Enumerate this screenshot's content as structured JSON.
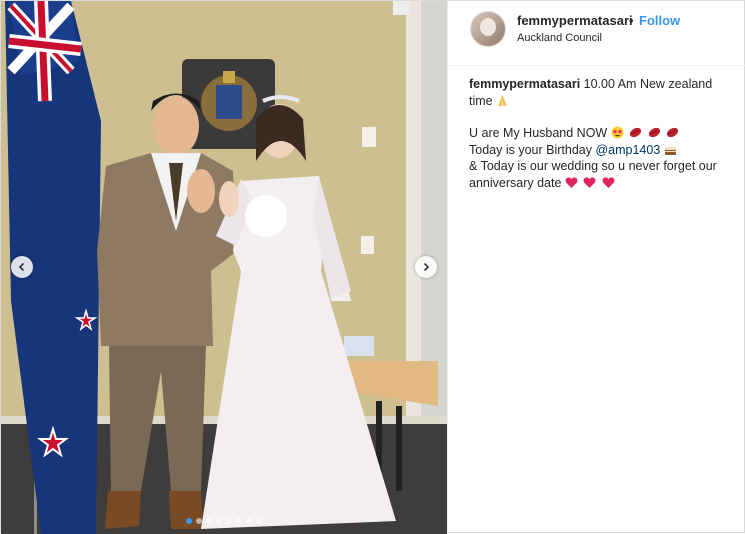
{
  "post": {
    "username": "femmypermatasari",
    "separator": "•",
    "follow_label": "Follow",
    "location": "Auckland Council"
  },
  "caption": {
    "author": "femmypermatasari",
    "line1": "10.00 Am New zealand time",
    "line2": "U are My Husband NOW",
    "line3_prefix": "Today is your Birthday",
    "mention": "@amp1403",
    "line4": "& Today is our wedding so u never forget our anniversary date"
  },
  "carousel": {
    "slide_count": 8,
    "active_index": 0
  },
  "icons": {
    "prev": "chevron-left-icon",
    "next": "chevron-right-icon",
    "pray": "praying-hands-emoji",
    "heart": "red-heart-emoji",
    "kiss": "kiss-lips-emoji",
    "cake": "cake-emoji",
    "star_eyes": "star-struck-emoji"
  },
  "colors": {
    "follow": "#3897f0",
    "mention": "#003569",
    "heart": "#e0245e"
  }
}
